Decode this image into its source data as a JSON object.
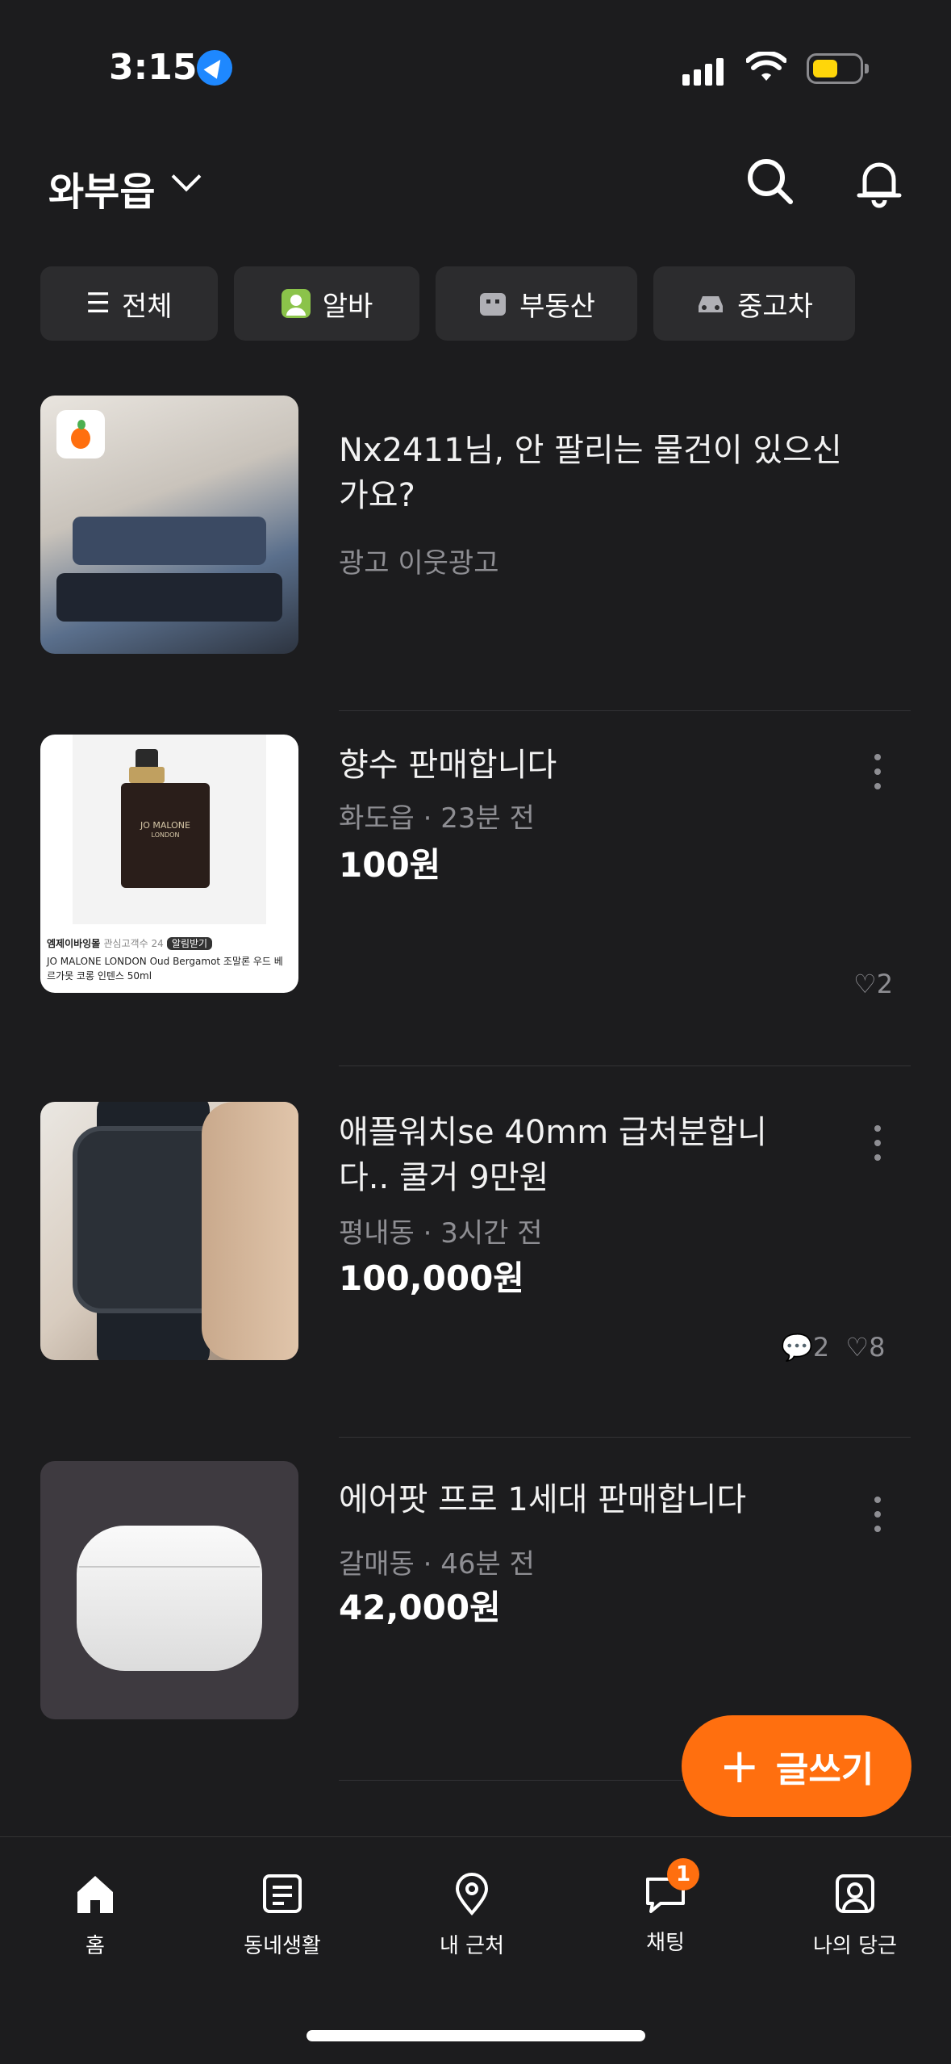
{
  "status_bar": {
    "time": "3:15"
  },
  "header": {
    "location": "와부읍"
  },
  "chips": [
    {
      "label": "전체"
    },
    {
      "label": "알바"
    },
    {
      "label": "부동산"
    },
    {
      "label": "중고차"
    }
  ],
  "items": [
    {
      "title": "Nx2411님, 안 팔리는 물건이 있으신가요?",
      "meta": "광고 이웃광고",
      "price": ""
    },
    {
      "title": "향수 판매합니다",
      "meta": "화도읍 · 23분 전",
      "price": "100원",
      "likes": "2",
      "thumb_brand": "JO MALONE",
      "thumb_city": "LONDON",
      "thumb_caption_seller": "엠제이바잉몰",
      "thumb_caption_interest": "관심고객수 24",
      "thumb_caption_alert": "알림받기",
      "thumb_caption_product": "JO MALONE LONDON Oud Bergamot 조말론 우드 베르가못 코롱 인텐스 50ml"
    },
    {
      "title": "애플워치se 40mm 급처분합니다.. 쿨거 9만원",
      "meta": "평내동 · 3시간 전",
      "price": "100,000원",
      "chats": "2",
      "likes": "8"
    },
    {
      "title": "에어팟 프로 1세대 판매합니다",
      "meta": "갈매동 · 46분 전",
      "price": "42,000원"
    }
  ],
  "fab": {
    "label": "글쓰기",
    "plus": "+"
  },
  "bottom_nav": [
    {
      "label": "홈"
    },
    {
      "label": "동네생활"
    },
    {
      "label": "내 근처"
    },
    {
      "label": "채팅"
    },
    {
      "label": "나의 당근"
    }
  ],
  "chat_badge": "1",
  "colors": {
    "accent": "#ff6f0f",
    "background": "#1c1c1e",
    "chip": "#2c2c2e"
  }
}
